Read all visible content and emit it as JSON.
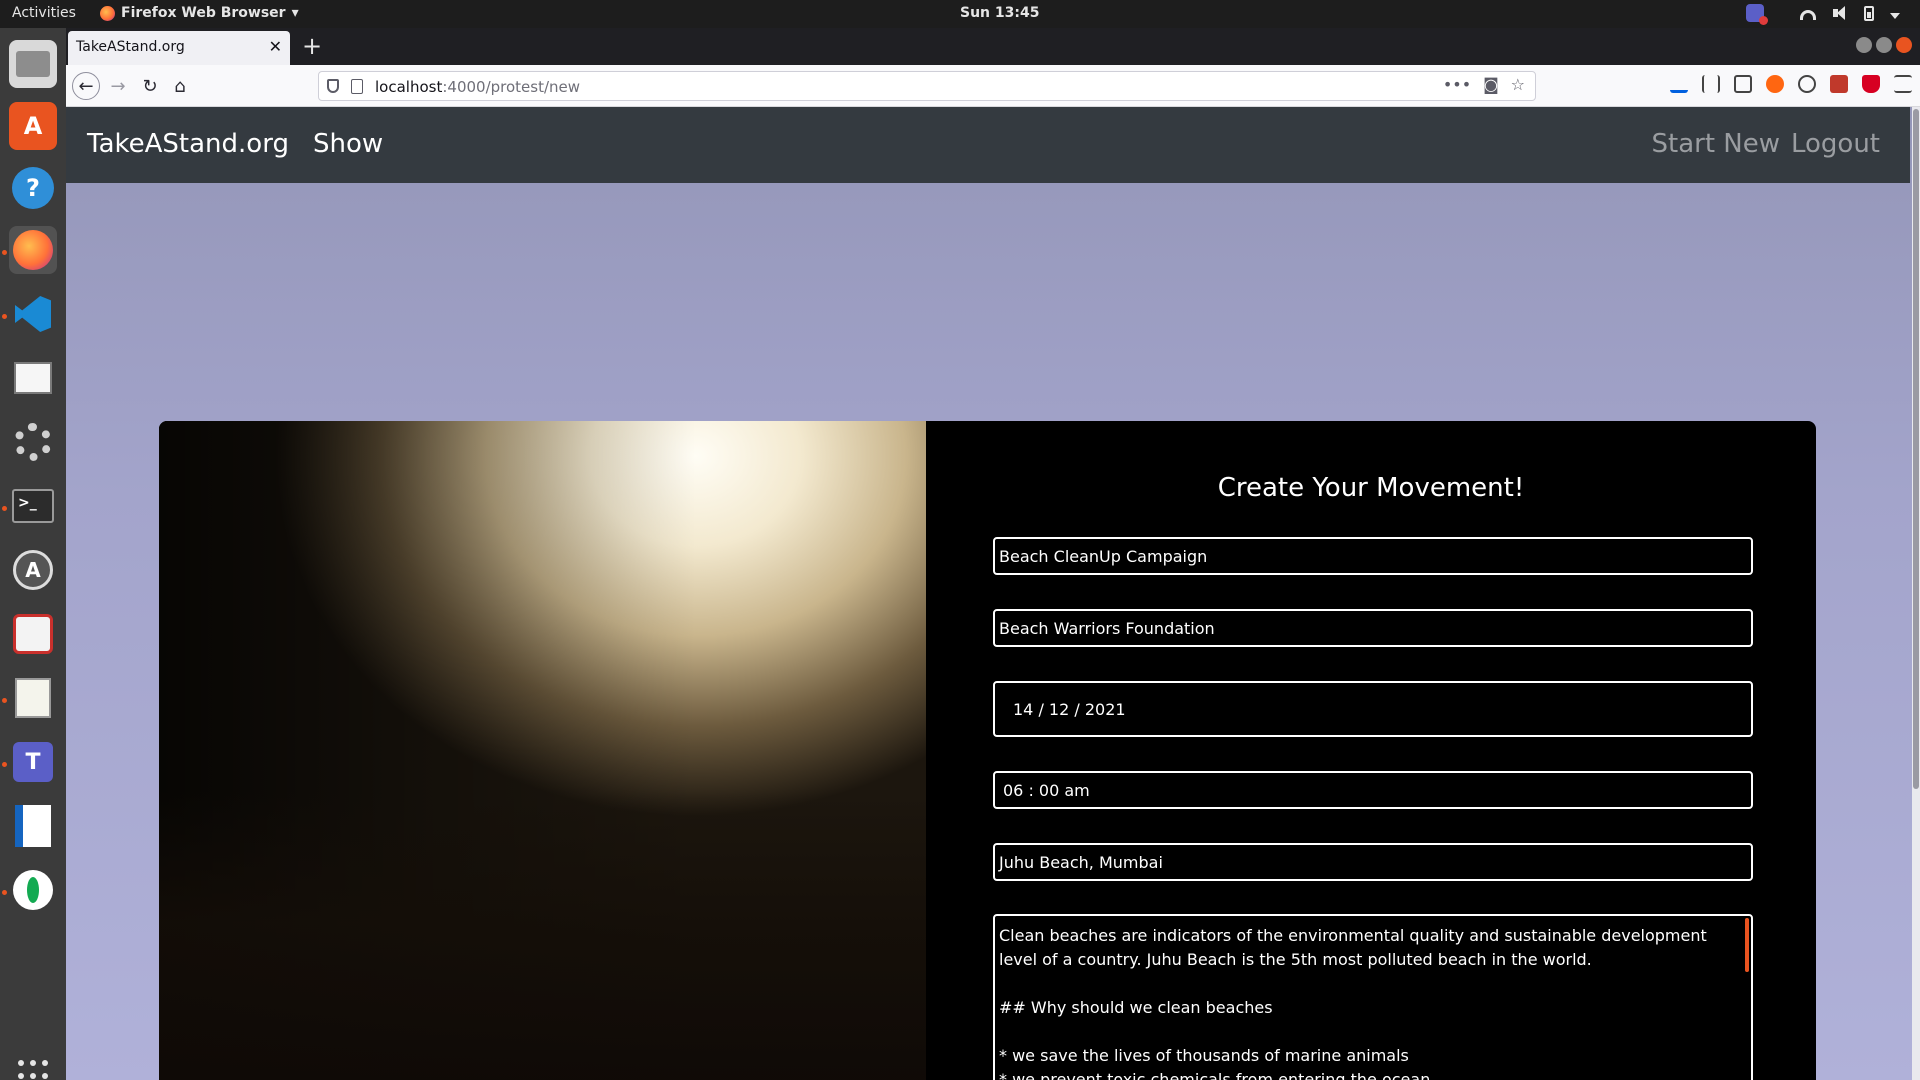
{
  "topbar": {
    "activities": "Activities",
    "app_name": "Firefox Web Browser",
    "clock": "Sun 13:45"
  },
  "dock": {
    "items": [
      "files",
      "ubuntu-software",
      "help",
      "firefox",
      "vscode",
      "sheets",
      "settings",
      "terminal",
      "updater",
      "draw",
      "text-editor",
      "teams",
      "writer",
      "mongodb"
    ]
  },
  "browser": {
    "tab_title": "TakeAStand.org",
    "url_host": "localhost",
    "url_path": ":4000/protest/new"
  },
  "site": {
    "brand": "TakeAStand.org",
    "nav_show": "Show",
    "nav_start": "Start New",
    "nav_logout": "Logout"
  },
  "form": {
    "title": "Create Your Movement!",
    "name": "Beach CleanUp Campaign",
    "organizer": "Beach Warriors Foundation",
    "date": "14 / 12 / 2021",
    "time": "06 : 00  am",
    "location": "Juhu Beach, Mumbai",
    "description": "Clean beaches are indicators of the environmental quality and sustainable development level of a country. Juhu Beach is the 5th most polluted beach in the world.\n\n## Why should we clean beaches\n\n* we save the lives of thousands of marine animals\n* we prevent toxic chemicals from entering the ocean"
  },
  "colors": {
    "navbar_bg": "#343a40",
    "page_bg": "#a3a4cb",
    "card_bg": "#000000",
    "accent": "#e95420"
  }
}
